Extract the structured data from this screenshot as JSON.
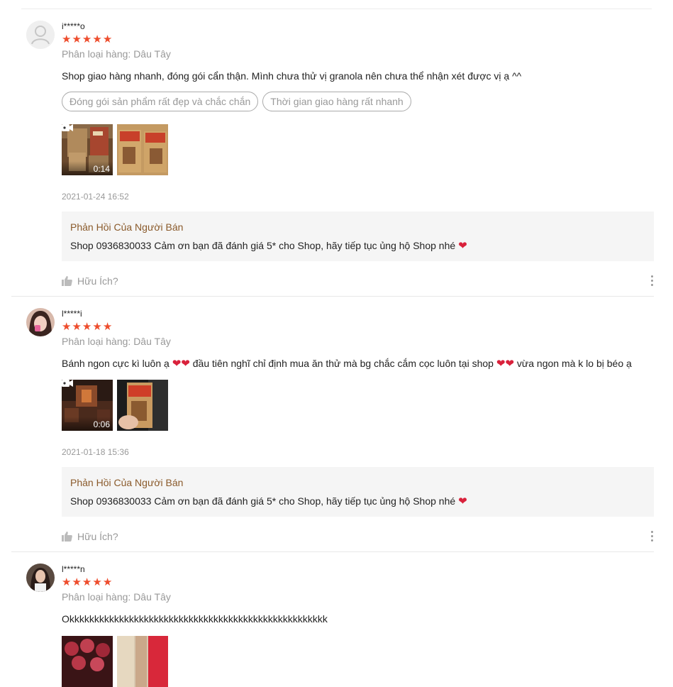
{
  "reviews": [
    {
      "username": "i*****o",
      "rating": 5,
      "variation": "Phân loại hàng: Dâu Tây",
      "comment": "Shop giao hàng nhanh, đóng gói cẩn thận. Mình chưa thử vị granola nên chưa thể nhận xét được vị ạ ^^",
      "tags": [
        "Đóng gói sản phẩm rất đẹp và chắc chắn",
        "Thời gian giao hàng rất nhanh"
      ],
      "video_duration": "0:14",
      "timestamp": "2021-01-24 16:52",
      "reply_title": "Phản Hồi Của Người Bán",
      "reply_text": "Shop 0936830033 Cảm ơn bạn đã đánh giá 5* cho Shop, hãy tiếp tục ủng hộ Shop nhé",
      "helpful_label": "Hữu Ích?"
    },
    {
      "username": "l*****i",
      "rating": 5,
      "variation": "Phân loại hàng: Dâu Tây",
      "comment_parts": [
        "Bánh ngon cực kì luôn ạ",
        "đầu tiên nghĩ chỉ định mua ăn thử mà bg chắc cắm cọc luôn tại shop",
        "vừa ngon mà k lo bị béo ạ"
      ],
      "video_duration": "0:06",
      "timestamp": "2021-01-18 15:36",
      "reply_title": "Phản Hồi Của Người Bán",
      "reply_text": "Shop 0936830033 Cảm ơn bạn đã đánh giá 5* cho Shop, hãy tiếp tục ủng hộ Shop nhé",
      "helpful_label": "Hữu Ích?"
    },
    {
      "username": "l*****n",
      "rating": 5,
      "variation": "Phân loại hàng: Dâu Tây",
      "comment": "Okkkkkkkkkkkkkkkkkkkkkkkkkkkkkkkkkkkkkkkkkkkkkkkkkkkk"
    }
  ],
  "icons": {
    "star": "star-icon",
    "heart": "heart-icon",
    "like": "thumbs-up-icon",
    "video": "video-camera-icon",
    "more": "more-vertical-icon"
  },
  "colors": {
    "star": "#ee4d2d",
    "heart": "#d9213b",
    "reply_title": "#8a5a2b",
    "muted": "#999999",
    "reply_bg": "#f5f5f5"
  }
}
